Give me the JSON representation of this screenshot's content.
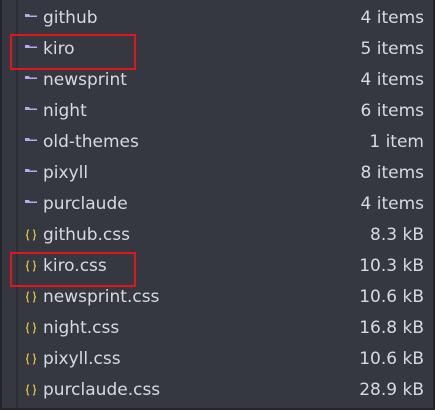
{
  "files": [
    {
      "name": "github",
      "size": "4 items",
      "icon": "folder-icon"
    },
    {
      "name": "kiro",
      "size": "5 items",
      "icon": "folder-icon"
    },
    {
      "name": "newsprint",
      "size": "4 items",
      "icon": "folder-icon"
    },
    {
      "name": "night",
      "size": "6 items",
      "icon": "folder-icon"
    },
    {
      "name": "old-themes",
      "size": "1 item",
      "icon": "folder-icon"
    },
    {
      "name": "pixyll",
      "size": "8 items",
      "icon": "folder-icon"
    },
    {
      "name": "purclaude",
      "size": "4 items",
      "icon": "folder-icon"
    },
    {
      "name": "github.css",
      "size": "8.3 kB",
      "icon": "css-file-icon"
    },
    {
      "name": "kiro.css",
      "size": "10.3 kB",
      "icon": "css-file-icon"
    },
    {
      "name": "newsprint.css",
      "size": "10.6 kB",
      "icon": "css-file-icon"
    },
    {
      "name": "night.css",
      "size": "16.8 kB",
      "icon": "css-file-icon"
    },
    {
      "name": "pixyll.css",
      "size": "10.6 kB",
      "icon": "css-file-icon"
    },
    {
      "name": "purclaude.css",
      "size": "28.9 kB",
      "icon": "css-file-icon"
    }
  ],
  "colors": {
    "folder_icon": "#b8a8f0",
    "css_icon": "#d8c23a",
    "highlight": "#e0161c"
  }
}
